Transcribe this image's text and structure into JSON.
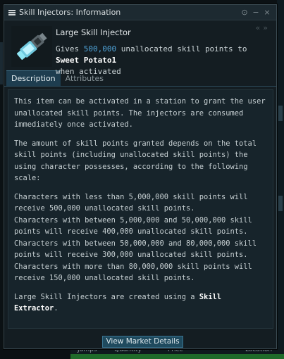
{
  "window": {
    "title": "Skill Injectors: Information",
    "buttons": {
      "info": "⊙",
      "minimize": "−",
      "close": "×"
    },
    "history": {
      "back": "«",
      "forward": "»"
    }
  },
  "item": {
    "name": "Large Skill Injector",
    "icon": "skill-injector-icon",
    "desc_prefix": "Gives ",
    "desc_amount": "500,000",
    "desc_middle": " unallocated skill points to ",
    "desc_target": "Sweet Potato1",
    "desc_suffix": "when activated"
  },
  "tabs": [
    {
      "label": "Description",
      "active": true
    },
    {
      "label": "Attributes",
      "active": false
    }
  ],
  "description": {
    "para1": "This item can be activated in a station to grant the user unallocated skill points. The injectors are consumed immediately once activated.",
    "para2": "The amount of skill points granted depends on the total skill points (including unallocated skill points) the using character possesses, according to the following scale:",
    "scale": [
      "Characters with less than 5,000,000 skill points will receive 500,000 unallocated skill points.",
      "Characters with between 5,000,000 and 50,000,000 skill points will receive 400,000 unallocated skill points.",
      "Characters with between 50,000,000 and 80,000,000 skill points will receive 300,000 unallocated skill points.",
      "Characters with more than 80,000,000 skill points will receive 150,000 unallocated skill points."
    ],
    "para4_prefix": "Large Skill Injectors are created using a ",
    "para4_bold": "Skill Extractor",
    "para4_suffix": "."
  },
  "footer": {
    "market_button": "View Market Details"
  },
  "background": {
    "market_headers": [
      "Jumps",
      "Quantity",
      "Price",
      "Location"
    ]
  },
  "colors": {
    "accent": "#4fa3d8",
    "tab_active": "#1e3d4f",
    "button_bg": "#1f4a5e",
    "window_bg": "#141d22"
  }
}
